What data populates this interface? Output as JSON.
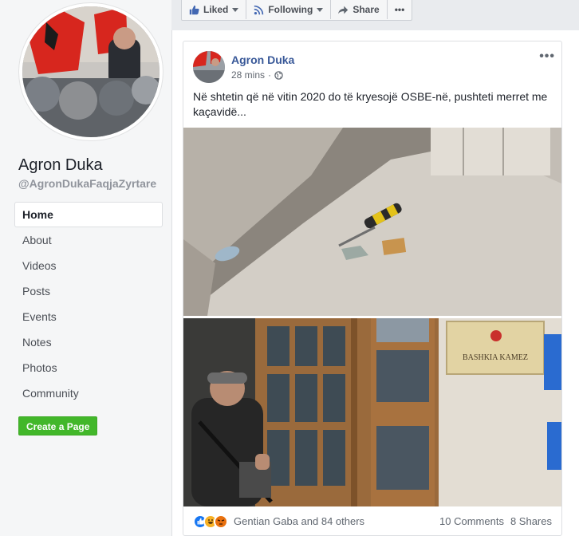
{
  "page": {
    "name": "Agron Duka",
    "handle": "@AgronDukaFaqjaZyrtare",
    "nav": [
      "Home",
      "About",
      "Videos",
      "Posts",
      "Events",
      "Notes",
      "Photos",
      "Community"
    ],
    "create_page": "Create a Page"
  },
  "actionbar": {
    "liked": "Liked",
    "following": "Following",
    "share": "Share",
    "more": "•••"
  },
  "post": {
    "author": "Agron Duka",
    "time": "28 mins",
    "dot": "·",
    "more": "•••",
    "text": "Në shtetin që në vitin 2020 do të kryesojë OSBE-në, pushteti merret me kaçavidë...",
    "sign_text": "BASHKIA KAMEZ",
    "reacted_by": "Gentian Gaba and 84 others",
    "comments": "10 Comments",
    "shares": "8 Shares"
  },
  "colors": {
    "link": "#385898",
    "green": "#42b72a",
    "like_blue": "#1877f2"
  }
}
